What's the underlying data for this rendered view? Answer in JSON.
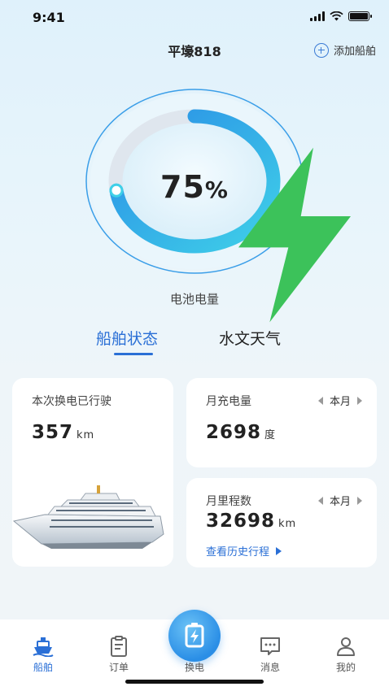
{
  "status_bar": {
    "time": "9:41"
  },
  "header": {
    "title": "平壕818",
    "add_ship_label": "添加船舶"
  },
  "battery": {
    "percent": 75,
    "value_text": "75",
    "unit": "%",
    "label": "电池电量"
  },
  "tabs": [
    {
      "label": "船舶状态",
      "active": true
    },
    {
      "label": "水文天气",
      "active": false
    }
  ],
  "cards": {
    "drive": {
      "title": "本次换电已行驶",
      "value": "357",
      "unit": "km"
    },
    "charge": {
      "title": "月充电量",
      "period": "本月",
      "value": "2698",
      "unit": "度"
    },
    "mileage": {
      "title": "月里程数",
      "period": "本月",
      "value": "32698",
      "unit": "km",
      "link": "查看历史行程"
    }
  },
  "tabbar": [
    {
      "label": "船舶",
      "icon": "ship-icon",
      "active": true
    },
    {
      "label": "订单",
      "icon": "clipboard-icon",
      "active": false
    },
    {
      "label": "换电",
      "icon": "battery-swap-icon",
      "active": false
    },
    {
      "label": "消息",
      "icon": "message-icon",
      "active": false
    },
    {
      "label": "我的",
      "icon": "user-icon",
      "active": false
    }
  ],
  "colors": {
    "accent": "#2a6fd6",
    "gauge_start": "#2a8ee6",
    "gauge_end": "#3fd0e8",
    "bolt": "#3cc25a"
  }
}
